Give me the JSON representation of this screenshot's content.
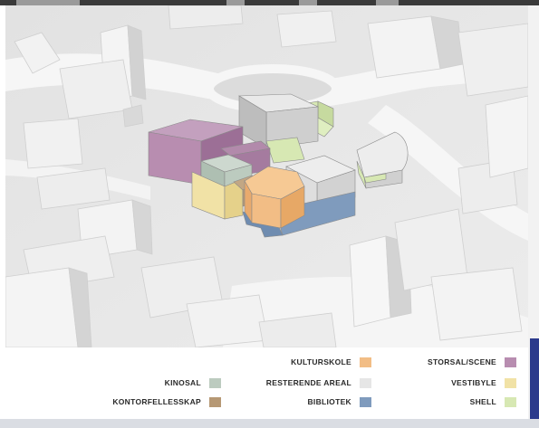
{
  "colors": {
    "kulturskole": "#f2bd85",
    "storsal_scene": "#b88db0",
    "kinosal": "#bccbbf",
    "resterende_areal": "#e6e6e6",
    "vestibyle": "#f1e2a6",
    "kontorfellesskap": "#b69874",
    "bibliotek": "#7f9bbd",
    "shell": "#d7e8b3",
    "side_accent": "#2b3a8c"
  },
  "legend": {
    "kulturskole": "KULTURSKOLE",
    "storsal_scene": "STORSAL/SCENE",
    "kinosal": "KINOSAL",
    "resterende_areal": "RESTERENDE AREAL",
    "vestibyle": "VESTIBYLE",
    "kontorfellesskap": "KONTORFELLESSKAP",
    "bibliotek": "BIBLIOTEK",
    "shell": "SHELL"
  }
}
